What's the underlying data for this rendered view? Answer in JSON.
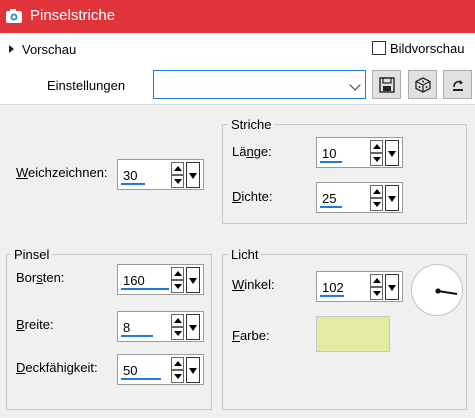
{
  "window": {
    "title": "Pinselstriche"
  },
  "preview": {
    "label": "Vorschau",
    "checkbox_label": "Bildvorschau",
    "checked": false
  },
  "settings": {
    "label": "Einstellungen",
    "value": ""
  },
  "toolbar_icons": [
    "save-icon",
    "dice-icon",
    "reset-icon"
  ],
  "strokes_group": {
    "title": "Striche",
    "length": {
      "label": "Länge:",
      "value": "10"
    },
    "density": {
      "label": "Dichte:",
      "value": "25"
    }
  },
  "softness": {
    "label": "Weichzeichnen:",
    "value": "30"
  },
  "brush_group": {
    "title": "Pinsel",
    "bristles": {
      "label": "Borsten:",
      "value": "160"
    },
    "width": {
      "label": "Breite:",
      "value": "8"
    },
    "opacity": {
      "label": "Deckfähigkeit:",
      "value": "50"
    }
  },
  "light_group": {
    "title": "Licht",
    "angle": {
      "label": "Winkel:",
      "value": "102"
    },
    "color": {
      "label": "Farbe:",
      "value": "#e3eba1"
    }
  },
  "colors": {
    "titlebar": "#e0343a",
    "accent": "#1e7ad8",
    "swatch": "#e3eba1"
  }
}
